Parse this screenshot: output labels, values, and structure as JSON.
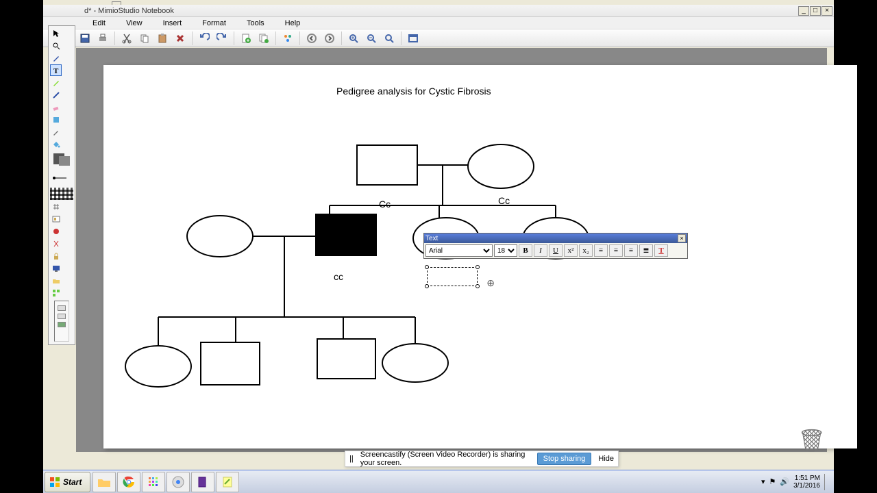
{
  "window": {
    "title": "d* - MimioStudio Notebook",
    "float_close": "×",
    "min": "_",
    "max": "□",
    "close": "×"
  },
  "menu": {
    "edit": "Edit",
    "view": "View",
    "insert": "Insert",
    "format": "Format",
    "tools": "Tools",
    "help": "Help"
  },
  "canvas": {
    "title": "Pedigree analysis for Cystic Fibrosis",
    "labels": {
      "Cc1": "Cc",
      "Cc2": "Cc",
      "cc": "cc"
    }
  },
  "text_toolbar": {
    "title": "Text",
    "close": "×",
    "font": "Arial",
    "size": "18",
    "bold": "B",
    "italic": "I",
    "underline": "U",
    "super": "x²",
    "sub": "x₂",
    "align_left": "≡",
    "align_center": "≡",
    "align_right": "≡",
    "list": "≣",
    "color": "T"
  },
  "move_handle": "⊕",
  "cast": {
    "pause": "||",
    "msg": "Screencastify (Screen Video Recorder) is sharing your screen.",
    "stop": "Stop sharing",
    "hide": "Hide"
  },
  "taskbar": {
    "start": "Start",
    "time": "1:51 PM",
    "date": "3/1/2016"
  },
  "trash": "🗑"
}
